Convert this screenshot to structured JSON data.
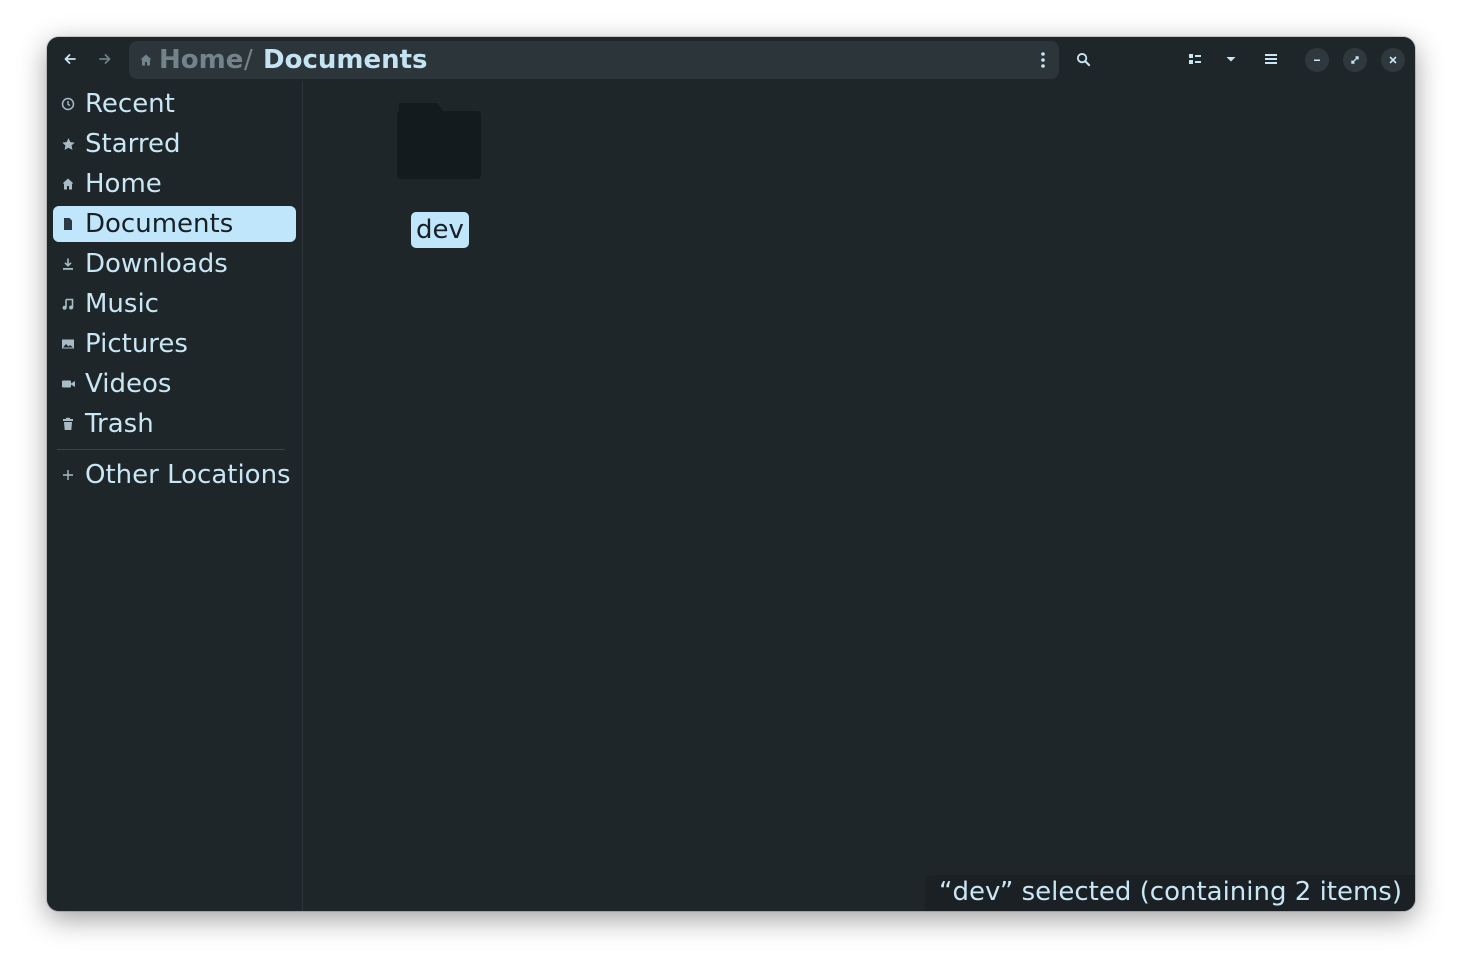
{
  "pathbar": {
    "home_label": "Home",
    "separator": "/",
    "current_label": "Documents"
  },
  "sidebar": {
    "items": [
      {
        "label": "Recent",
        "icon": "clock-icon"
      },
      {
        "label": "Starred",
        "icon": "star-icon"
      },
      {
        "label": "Home",
        "icon": "home-icon"
      },
      {
        "label": "Documents",
        "icon": "document-icon",
        "selected": true
      },
      {
        "label": "Downloads",
        "icon": "download-icon"
      },
      {
        "label": "Music",
        "icon": "music-icon"
      },
      {
        "label": "Pictures",
        "icon": "picture-icon"
      },
      {
        "label": "Videos",
        "icon": "video-icon"
      },
      {
        "label": "Trash",
        "icon": "trash-icon"
      }
    ],
    "other_locations": {
      "label": "Other Locations",
      "icon": "plus-icon"
    }
  },
  "files": [
    {
      "name": "dev",
      "type": "folder",
      "selected": true
    }
  ],
  "status": {
    "text": "“dev” selected (containing 2 items)"
  },
  "colors": {
    "window_bg": "#1f262a",
    "accent": "#bfe6fa",
    "text": "#c9e6f5",
    "dim_text": "#73838c"
  }
}
